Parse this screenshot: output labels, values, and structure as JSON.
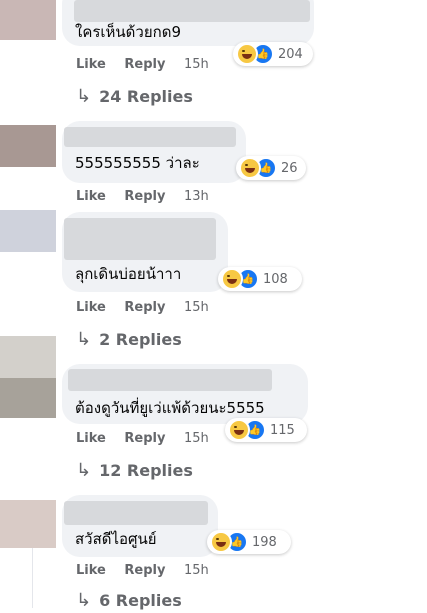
{
  "comments": [
    {
      "text": "ใครเห็นด้วยกด9",
      "count": "204"
    },
    {
      "text": "555555555 ว่าละ",
      "count": "26"
    },
    {
      "text": "ลุกเดินบ่อยน้าาา",
      "count": "108"
    },
    {
      "text": "ต้องดูวันที่ยูเว่แพ้ด้วยนะ5555",
      "count": "115"
    },
    {
      "text": "สวัสดีไอศูนย์",
      "count": "198"
    }
  ],
  "actions": {
    "like": "Like",
    "reply": "Reply"
  },
  "times": [
    "15h",
    "13h",
    "15h",
    "15h",
    "15h"
  ],
  "replies": [
    "24 Replies",
    "2 Replies",
    "12 Replies",
    "6 Replies"
  ],
  "icons": {
    "reply_arrow": "↳",
    "like": "👍"
  },
  "colors": {
    "bubble": "#f0f2f5",
    "like_blue": "#1877f2",
    "muted": "#65676b"
  }
}
